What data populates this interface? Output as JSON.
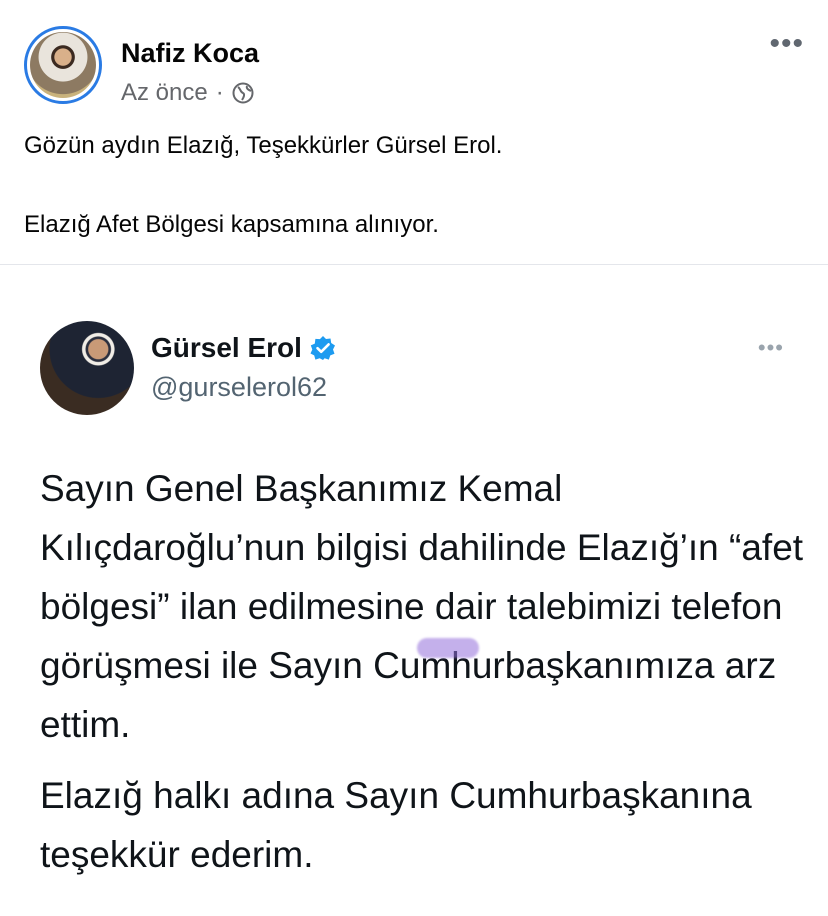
{
  "post": {
    "author": "Nafiz Koca",
    "time": "Az önce",
    "separator": "·",
    "audience_icon": "globe-icon",
    "more_icon": "more-horizontal-icon",
    "more_glyph": "•••",
    "text_line_1": "Gözün aydın Elazığ, Teşekkürler Gürsel Erol.",
    "text_line_2": "Elazığ Afet Bölgesi kapsamına alınıyor."
  },
  "tweet": {
    "name": "Gürsel Erol",
    "verified_icon": "verified-badge-icon",
    "handle": "@gurselerol62",
    "more_glyph": "•••",
    "paragraph_1": "Sayın Genel Başkanımız Kemal Kılıçdaroğlu’nun bilgisi dahilinde Elazığ’ın “afet bölgesi” ilan edilmesine dair talebimizi telefon görüşmesi ile Sayın Cumhurbaşkanımıza arz ettim.",
    "paragraph_2": "Elazığ halkı adına Sayın Cumhurbaşkanına teşekkür ederim."
  },
  "colors": {
    "accent_blue": "#2a7be4",
    "secondary_text": "#65676b",
    "verified_blue": "#1d9bf0",
    "highlight_purple": "#9370db"
  }
}
